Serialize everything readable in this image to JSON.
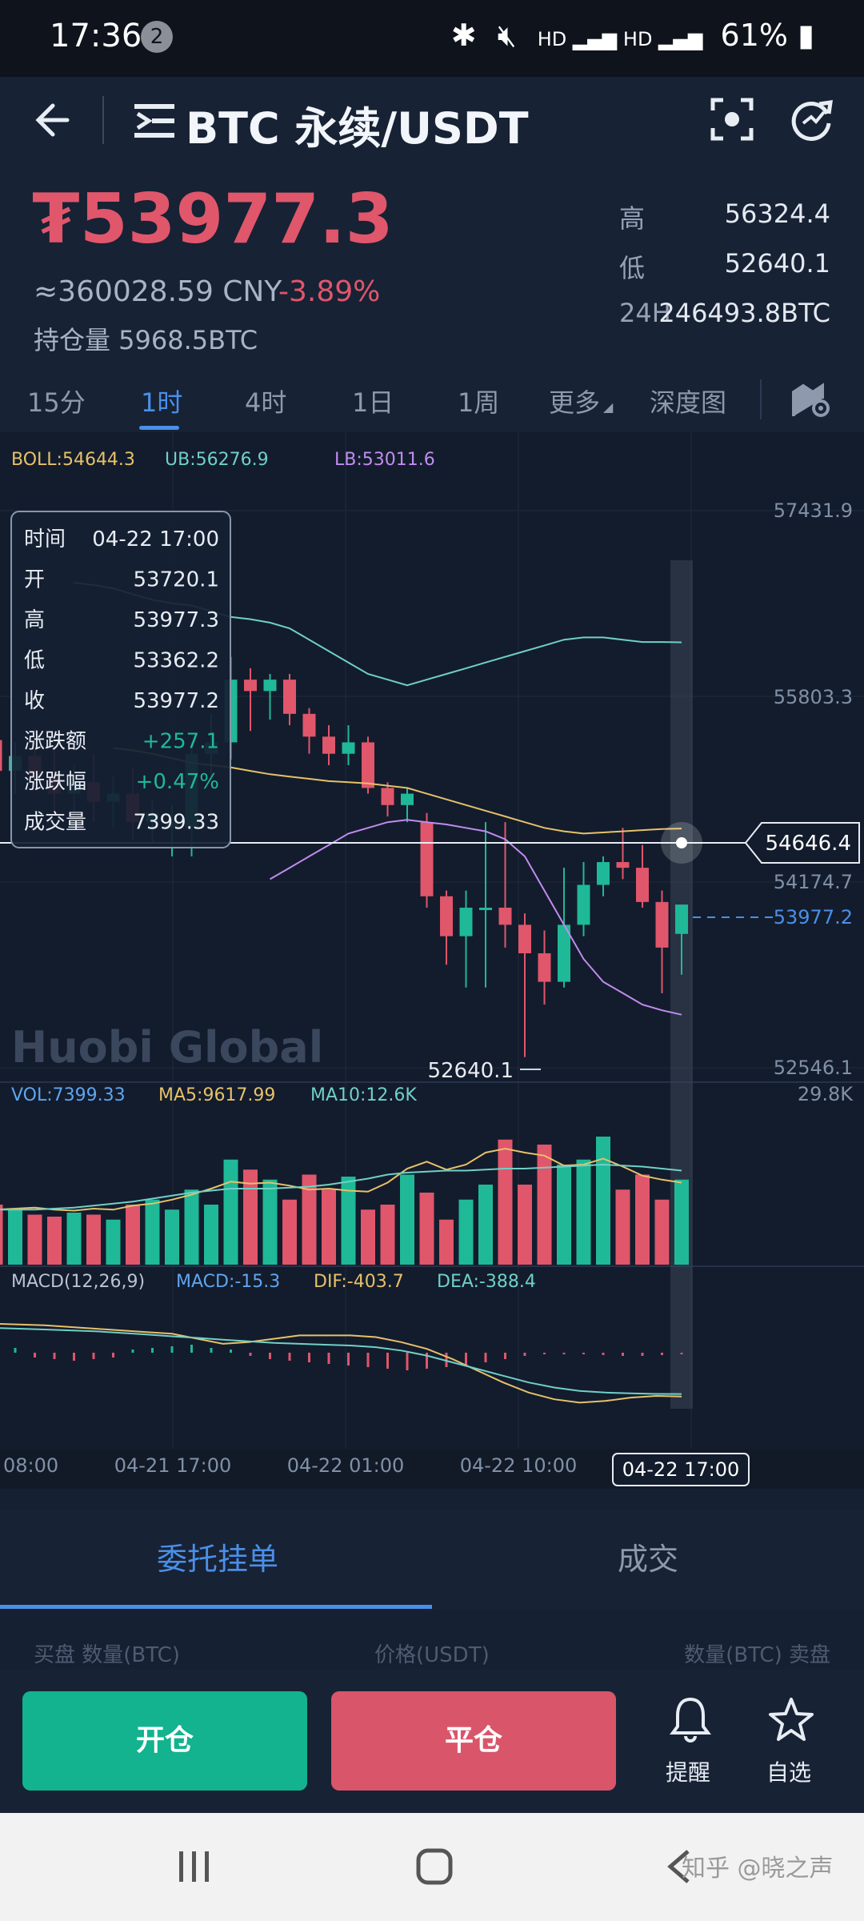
{
  "status_bar": {
    "time": "17:36",
    "notification_count": "2",
    "battery": "61%"
  },
  "header": {
    "title": "BTC 永续/USDT"
  },
  "ticker": {
    "price": "₮53977.3",
    "cny": "≈360028.59 CNY",
    "change": "-3.89%",
    "position_label": "持仓量 5968.5BTC",
    "high_label": "高",
    "high_value": "56324.4",
    "low_label": "低",
    "low_value": "52640.1",
    "vol24_label": "24H",
    "vol24_value": "246493.8BTC"
  },
  "timeframes": [
    "15分",
    "1时",
    "4时",
    "1日",
    "1周",
    "更多",
    "深度图"
  ],
  "active_timeframe": "1时",
  "indicators": {
    "boll": "BOLL:54644.3",
    "ub": "UB:56276.9",
    "lb": "LB:53011.6",
    "vol": "VOL:7399.33",
    "ma5": "MA5:9617.99",
    "ma10": "MA10:12.6K",
    "macd_title": "MACD(12,26,9)",
    "macd": "MACD:-15.3",
    "dif": "DIF:-403.7",
    "dea": "DEA:-388.4"
  },
  "tooltip": {
    "rows": [
      {
        "label": "时间",
        "value": "04-22 17:00"
      },
      {
        "label": "开",
        "value": "53720.1"
      },
      {
        "label": "高",
        "value": "53977.3"
      },
      {
        "label": "低",
        "value": "53362.2"
      },
      {
        "label": "收",
        "value": "53977.2"
      },
      {
        "label": "涨跌额",
        "value": "+257.1"
      },
      {
        "label": "涨跌幅",
        "value": "+0.47%"
      },
      {
        "label": "成交量",
        "value": "7399.33"
      }
    ]
  },
  "watermark": "Huobi Global",
  "crosshair_value": "54646.4",
  "current_price_label": "53977.2",
  "min_label": "52640.1",
  "colors": {
    "up": "#1fb997",
    "down": "#e0566b",
    "accent": "#4a8fe8",
    "bg": "#152033"
  },
  "chart_data": {
    "type": "candlestick",
    "y_axis_ticks": [
      "57431.9",
      "55803.3",
      "54174.7",
      "52546.1"
    ],
    "vol_axis_max": "29.8K",
    "x_ticks": [
      "08:00",
      "04-21 17:00",
      "04-22 01:00",
      "04-22 10:00",
      "04-22 17:00"
    ],
    "candles": [
      {
        "o": 55450,
        "h": 55680,
        "c": 55180,
        "l": 54920
      },
      {
        "o": 55180,
        "h": 55560,
        "c": 55320,
        "l": 55000
      },
      {
        "o": 55320,
        "h": 55650,
        "c": 55420,
        "l": 55120
      },
      {
        "o": 55420,
        "h": 55700,
        "c": 55150,
        "l": 55000
      },
      {
        "o": 55150,
        "h": 55400,
        "c": 55280,
        "l": 54950
      },
      {
        "o": 55280,
        "h": 55520,
        "c": 55100,
        "l": 54980
      },
      {
        "o": 55100,
        "h": 55350,
        "c": 54950,
        "l": 54800
      },
      {
        "o": 54950,
        "h": 55200,
        "c": 55050,
        "l": 54780
      },
      {
        "o": 55050,
        "h": 55300,
        "c": 54880,
        "l": 54700
      },
      {
        "o": 54880,
        "h": 55100,
        "c": 54950,
        "l": 54650
      },
      {
        "o": 54950,
        "h": 55180,
        "c": 54700,
        "l": 54550
      },
      {
        "o": 54700,
        "h": 54900,
        "c": 54780,
        "l": 54520
      },
      {
        "o": 54650,
        "h": 54850,
        "c": 54700,
        "l": 54400
      },
      {
        "o": 54650,
        "h": 55400,
        "c": 55300,
        "l": 54400
      },
      {
        "o": 55300,
        "h": 55650,
        "c": 55400,
        "l": 55100
      },
      {
        "o": 55400,
        "h": 56150,
        "c": 55950,
        "l": 55250
      },
      {
        "o": 55950,
        "h": 56050,
        "c": 55850,
        "l": 55500
      },
      {
        "o": 55850,
        "h": 56000,
        "c": 55950,
        "l": 55600
      },
      {
        "o": 55950,
        "h": 56000,
        "c": 55650,
        "l": 55550
      },
      {
        "o": 55650,
        "h": 55700,
        "c": 55450,
        "l": 55300
      },
      {
        "o": 55450,
        "h": 55550,
        "c": 55300,
        "l": 55200
      },
      {
        "o": 55300,
        "h": 55550,
        "c": 55400,
        "l": 55200
      },
      {
        "o": 55400,
        "h": 55450,
        "c": 55000,
        "l": 54950
      },
      {
        "o": 55000,
        "h": 55050,
        "c": 54850,
        "l": 54750
      },
      {
        "o": 54850,
        "h": 55000,
        "c": 54950,
        "l": 54700
      },
      {
        "o": 54700,
        "h": 54780,
        "c": 54050,
        "l": 53950
      },
      {
        "o": 54050,
        "h": 54100,
        "c": 53700,
        "l": 53450
      },
      {
        "o": 53700,
        "h": 54100,
        "c": 53950,
        "l": 53250
      },
      {
        "o": 53950,
        "h": 54700,
        "c": 53950,
        "l": 53250
      },
      {
        "o": 53950,
        "h": 54700,
        "c": 53800,
        "l": 53600
      },
      {
        "o": 53800,
        "h": 53900,
        "c": 53550,
        "l": 52640.1
      },
      {
        "o": 53550,
        "h": 53750,
        "c": 53300,
        "l": 53100
      },
      {
        "o": 53300,
        "h": 54300,
        "c": 53800,
        "l": 53250
      },
      {
        "o": 53800,
        "h": 54350,
        "c": 54150,
        "l": 53700
      },
      {
        "o": 54150,
        "h": 54400,
        "c": 54350,
        "l": 54050
      },
      {
        "o": 54350,
        "h": 54650,
        "c": 54300,
        "l": 54200
      },
      {
        "o": 54300,
        "h": 54500,
        "c": 54000,
        "l": 53950
      },
      {
        "o": 54000,
        "h": 54100,
        "c": 53600,
        "l": 53200
      },
      {
        "o": 53720.1,
        "h": 53977.3,
        "c": 53977.2,
        "l": 53362.2
      }
    ],
    "volumes": [
      5.0,
      6.2,
      4.5,
      5.8,
      6.0,
      5.5,
      5.0,
      4.8,
      5.2,
      5.0,
      4.5,
      6.0,
      6.5,
      5.5,
      7.5,
      6.0,
      10.5,
      9.5,
      8.5,
      6.5,
      9.0,
      7.5,
      8.8,
      5.5,
      6.0,
      9.0,
      7.2,
      4.5,
      6.5,
      8.0,
      12.5,
      8.0,
      12.0,
      10.0,
      10.5,
      12.8,
      7.5,
      9.0,
      6.5,
      8.5
    ],
    "vol_ma5": [
      5.5,
      5.8,
      5.4,
      5.6,
      5.5,
      5.6,
      5.7,
      5.5,
      5.4,
      5.6,
      5.5,
      5.9,
      6.1,
      6.5,
      7.0,
      7.6,
      8.3,
      8.1,
      8.2,
      7.9,
      7.5,
      7.6,
      7.4,
      7.3,
      8.2,
      9.6,
      10.3,
      9.5,
      10.0,
      11.2,
      11.6,
      11.2,
      10.9,
      9.9,
      10.0,
      10.6,
      9.8,
      8.9,
      8.5,
      8.2
    ],
    "vol_ma10": [
      5.6,
      5.6,
      5.5,
      5.5,
      5.5,
      5.5,
      5.5,
      5.6,
      5.7,
      5.9,
      6.1,
      6.3,
      6.6,
      6.9,
      7.2,
      7.4,
      7.6,
      7.6,
      7.6,
      7.7,
      7.8,
      8.0,
      8.3,
      8.6,
      9.0,
      9.2,
      9.3,
      9.4,
      9.4,
      9.5,
      9.6,
      9.6,
      9.7,
      9.8,
      9.9,
      10.0,
      9.9,
      9.8,
      9.6,
      9.4
    ],
    "boll_ub": [
      56800,
      56780,
      56750,
      56700,
      56650,
      56620,
      56600,
      56550,
      56500,
      56480,
      56450,
      56400,
      56300,
      56200,
      56100,
      56000,
      55950,
      55900,
      55950,
      56000,
      56050,
      56100,
      56150,
      56200,
      56250,
      56300,
      56320,
      56320,
      56300,
      56280,
      56280,
      56276.9
    ],
    "boll_mid": [
      55350,
      55330,
      55300,
      55260,
      55220,
      55200,
      55180,
      55150,
      55120,
      55100,
      55080,
      55060,
      55050,
      55040,
      55020,
      55000,
      54950,
      54900,
      54850,
      54800,
      54750,
      54700,
      54650,
      54620,
      54600,
      54610,
      54620,
      54630,
      54640,
      54644.3
    ],
    "boll_lb": [
      54200,
      54300,
      54400,
      54500,
      54600,
      54650,
      54700,
      54720,
      54700,
      54680,
      54650,
      54620,
      54550,
      54400,
      54100,
      53800,
      53500,
      53300,
      53200,
      53100,
      53050,
      53011.6
    ],
    "macd_hist": [
      8,
      10,
      12,
      8,
      6,
      -6,
      -8,
      -10,
      -8,
      -6,
      4,
      6,
      8,
      10,
      6,
      4,
      -4,
      -8,
      -10,
      -12,
      -14,
      -16,
      -18,
      -20,
      -22,
      -20,
      -18,
      -16,
      -12,
      -8,
      -4,
      -2,
      -2,
      -2,
      -3,
      -4,
      -4,
      -3,
      -2
    ],
    "macd_dif": [
      40,
      35,
      30,
      25,
      20,
      10,
      0,
      -10,
      -20,
      -30,
      -60,
      -90,
      -80,
      -60,
      -40,
      -40,
      -40,
      -50,
      -80,
      -120,
      -180,
      -250,
      -320,
      -380,
      -420,
      -440,
      -430,
      -410,
      -400,
      -403.7
    ],
    "macd_dea": [
      10,
      5,
      0,
      -5,
      -10,
      -15,
      -25,
      -35,
      -45,
      -55,
      -65,
      -75,
      -85,
      -90,
      -95,
      -100,
      -110,
      -130,
      -160,
      -200,
      -240,
      -280,
      -320,
      -350,
      -370,
      -380,
      -385,
      -388,
      -388.4
    ]
  },
  "order_tabs": [
    "委托挂单",
    "成交"
  ],
  "order_header": [
    "买盘 数量(BTC)",
    "价格(USDT)",
    "数量(BTC) 卖盘"
  ],
  "actions": {
    "open": "开仓",
    "close": "平仓",
    "alert": "提醒",
    "favorite": "自选"
  },
  "footer_watermark": "知乎 @晓之声"
}
